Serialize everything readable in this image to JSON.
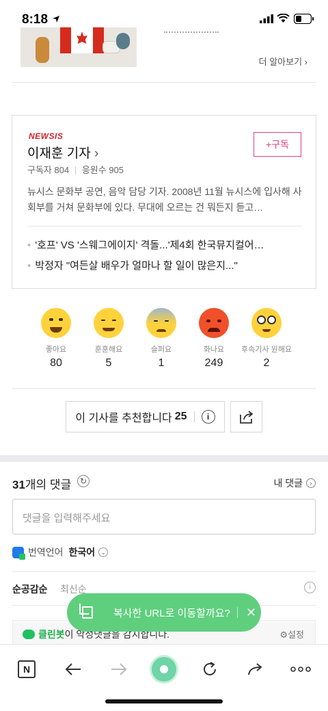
{
  "status_bar": {
    "time": "8:18"
  },
  "banner": {
    "more_label": "더 알아보기"
  },
  "reporter_card": {
    "outlet_logo": "NEWSIS",
    "name": "이재훈 기자",
    "name_chevron": "›",
    "subscribers": "구독자 804",
    "separator": "|",
    "supporters": "응원수 905",
    "subscribe_label": "+구독",
    "bio": "뉴시스 문화부 공연, 음악 담당 기자. 2008년 11월 뉴시스에 입사해 사회부를 거쳐 문화부에 있다. 무대에 오르는 건 뭐든지 듣고…",
    "articles": [
      "'호프' VS '스웨그에이지' 격돌...'제4회 한국뮤지컬어…",
      "박정자 \"여든살 배우가 얼마나 할 일이 많은지...\""
    ]
  },
  "reactions": [
    {
      "label": "좋아요",
      "count": "80",
      "color": "#ffd23c",
      "icon": "like-face-icon"
    },
    {
      "label": "훈훈해요",
      "count": "5",
      "color": "#ffd23c",
      "icon": "warm-face-icon"
    },
    {
      "label": "슬퍼요",
      "count": "1",
      "color": "#ffd23c",
      "icon": "sad-face-icon"
    },
    {
      "label": "화나요",
      "count": "249",
      "color": "#f0502a",
      "icon": "angry-face-icon"
    },
    {
      "label": "후속기사 원해요",
      "count": "2",
      "color": "#ffd23c",
      "icon": "glasses-face-icon"
    }
  ],
  "recommend": {
    "label": "이 기사를 추천합니다",
    "count": "25",
    "info": "i"
  },
  "comments": {
    "count": "31",
    "count_suffix": "개의 댓글",
    "my_comments": "내 댓글",
    "input_placeholder": "댓글을 입력해주세요",
    "translate_label": "번역언어",
    "translate_lang": "한국어",
    "sort_popular": "순공감순",
    "sort_latest": "최신순",
    "cleanbot_name": "클린봇",
    "cleanbot_text": "이 악성댓글을 감지합니다.",
    "settings": "설정"
  },
  "toast": {
    "message": "복사한 URL로 이동할까요?"
  },
  "bottom_nav": {
    "n_label": "N"
  }
}
